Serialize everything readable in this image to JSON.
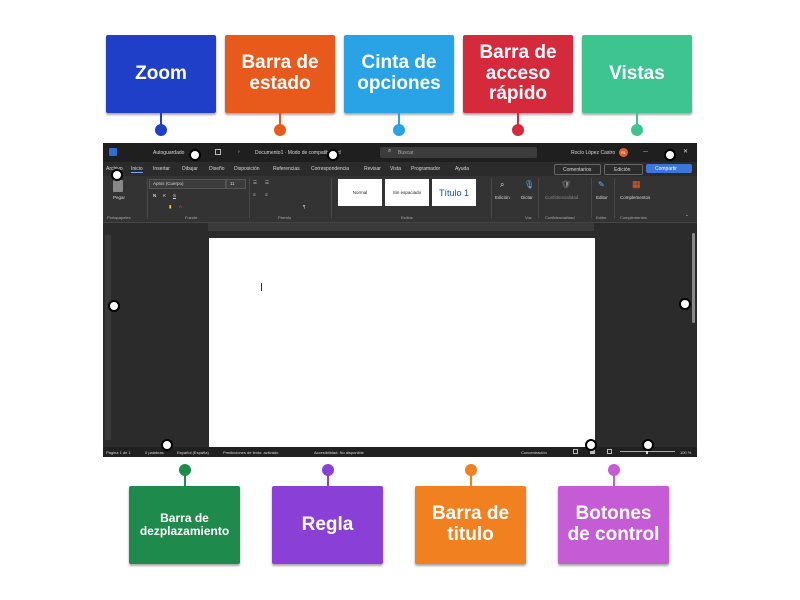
{
  "labels": {
    "zoom": "Zoom",
    "barra_estado": "Barra de estado",
    "cinta_opciones": "Cinta de opciones",
    "barra_acceso_rapido": "Barra de acceso rápido",
    "vistas": "Vistas",
    "barra_desplazamiento": "Barra de dezplazamiento",
    "regla": "Regla",
    "barra_titulo": "Barra de titulo",
    "botones_control": "Botones de control"
  },
  "colors": {
    "zoom": "#1f3fc8",
    "barra_estado": "#e85a1b",
    "cinta_opciones": "#29a3e6",
    "barra_acceso_rapido": "#d42a3c",
    "vistas": "#3ec491",
    "barra_desplazamiento": "#1e8a4b",
    "regla": "#8a3fd6",
    "barra_titulo": "#f08020",
    "botones_control": "#c65bd6"
  },
  "word": {
    "autosave": "Autoguardado",
    "doc_title": "Documento1 · Modo de compatibilidad",
    "search_placeholder": "Buscar",
    "user": "Rocío López Castro",
    "user_initials": "RL",
    "minimize": "—",
    "close": "✕",
    "menu": [
      "Archivo",
      "Inicio",
      "Insertar",
      "Dibujar",
      "Diseño",
      "Disposición",
      "Referencias",
      "Correspondencia",
      "Revisar",
      "Vista",
      "Programador",
      "Ayuda"
    ],
    "comments": "Comentarios",
    "editing": "Edición",
    "share": "Compartir",
    "paste": "Pegar",
    "font_name": "Aptos (Cuerpo)",
    "font_size": "11",
    "styles": [
      "Normal",
      "Sin espaciado",
      "Título 1"
    ],
    "edition": "Edición",
    "dictate": "Dictar",
    "confidentiality": "Confidencialidad",
    "editor": "Editor",
    "addins": "Complementos",
    "groups": [
      "Portapapeles",
      "Fuente",
      "Párrafo",
      "Estilos",
      "Voz",
      "Confidencialidad",
      "Editor",
      "Complementos"
    ],
    "status": {
      "page": "Página 1 de 1",
      "words": "0 palabras",
      "language": "Español (España)",
      "predictions": "Predicciones de texto: activado",
      "accessibility": "Accesibilidad: No disponible",
      "focus": "Concentración",
      "zoom": "100 %"
    }
  }
}
